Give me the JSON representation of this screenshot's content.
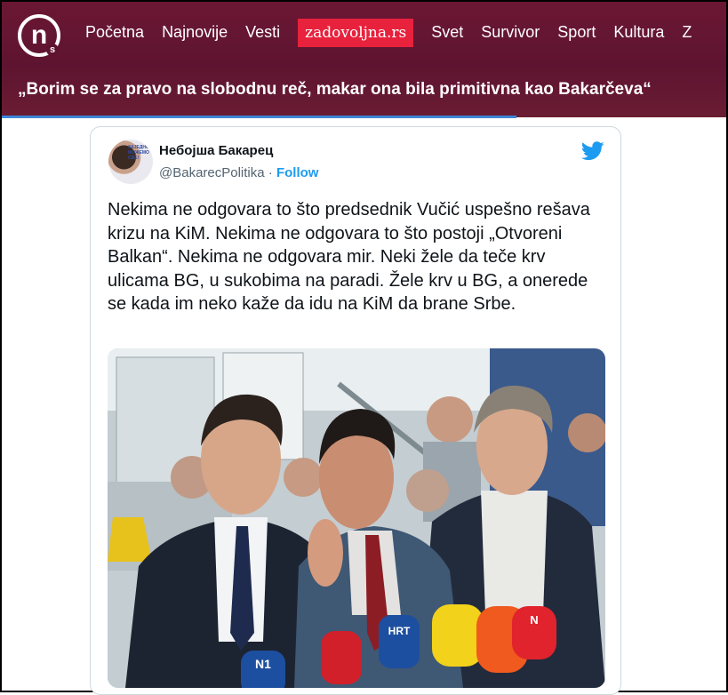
{
  "site": {
    "logo_letter": "n",
    "logo_sub": "s",
    "nav": [
      "Početna",
      "Najnovije",
      "Vesti",
      "zadovoljna.rs",
      "Svet",
      "Survivor",
      "Sport",
      "Kultura",
      "Z"
    ],
    "headline": "„Borim se za pravo na slobodnu reč, makar ona bila primitivna kao Bakarčeva“",
    "progress_fraction": 0.71
  },
  "tweet": {
    "author_name": "Небојша Бакарец",
    "handle": "@BakarecPolitika",
    "separator": "·",
    "follow_label": "Follow",
    "avatar_caption": "ЗАЈЕДНО МОЖЕМО СВЕ!",
    "text": "Nekima ne odgovara to što predsednik Vučić uspešno rešava krizu na KiM. Nekima ne odgovara to što postoji „Otvoreni Balkan“. Nekima ne odgovara mir. Neki žele da teče krv ulicama BG, u sukobima na paradi. Žele krv u BG, a onerede se kada im neko kaže da idu na KiM da brane Srbe.",
    "photo_mic_labels": [
      "N1",
      "HRT",
      "N"
    ]
  },
  "colors": {
    "brand_bar": "#5e1430",
    "zadovoljna_red": "#e8213c",
    "twitter_blue": "#1d9bf0",
    "progress_blue": "#3d86d8"
  },
  "icons": [
    "n-logo-icon",
    "twitter-bird-icon"
  ]
}
